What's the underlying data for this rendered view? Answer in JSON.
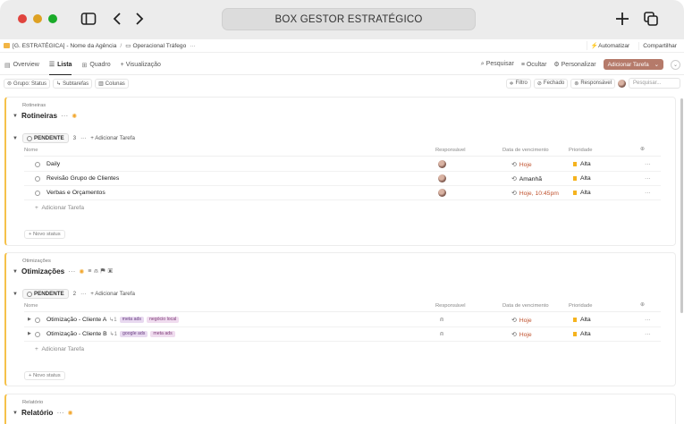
{
  "window": {
    "title": "BOX GESTOR ESTRATÉGICO"
  },
  "breadcrumb": {
    "space": "[G. ESTRATÉGICA] - Nome da Agência",
    "separator": "/",
    "list": "Operacional Tráfego",
    "more": "···",
    "automate": "Automatizar",
    "share": "Compartilhar"
  },
  "tabs": {
    "items": [
      {
        "label": "Overview",
        "icon": "▤"
      },
      {
        "label": "Lista",
        "icon": "☰"
      },
      {
        "label": "Quadro",
        "icon": "⊞"
      },
      {
        "label": "+ Visualização",
        "icon": ""
      }
    ],
    "search": "Pesquisar",
    "hide": "Ocultar",
    "customize": "Personalizar",
    "add_task": "Adicionar Tarefa"
  },
  "filters": {
    "group": "Grupo: Status",
    "subtasks": "Subtarefas",
    "columns": "Colunas",
    "filter": "Filtro",
    "closed": "Fechado",
    "assignee": "Responsável",
    "search_placeholder": "Pesquisar..."
  },
  "columns": {
    "name": "Nome",
    "assignee": "Responsável",
    "due": "Data de vencimento",
    "priority": "Prioridade"
  },
  "sections": [
    {
      "kicker": "Rotineiras",
      "title": "Rotineiras",
      "status": "PENDENTE",
      "count": "3",
      "add_task_label": "+ Adicionar Tarefa",
      "tasks": [
        {
          "name": "Daily",
          "due": "Hoje",
          "priority": "Alta"
        },
        {
          "name": "Revisão Grupo de Clientes",
          "due": "Amanhã",
          "priority": "Alta"
        },
        {
          "name": "Verbas e Orçamentos",
          "due": "Hoje, 10:45pm",
          "priority": "Alta"
        }
      ],
      "add_row": "Adicionar Tarefa",
      "new_status": "+ Novo status"
    },
    {
      "kicker": "Otimizações",
      "title": "Otimizações",
      "status": "PENDENTE",
      "count": "2",
      "add_task_label": "+ Adicionar Tarefa",
      "tasks": [
        {
          "name": "Otimização - Cliente A",
          "subcount": "1",
          "tags": [
            "meta ads",
            "negócio local"
          ],
          "due": "Hoje",
          "priority": "Alta"
        },
        {
          "name": "Otimização - Cliente B",
          "subcount": "1",
          "tags": [
            "google ads",
            "meta ads"
          ],
          "due": "Hoje",
          "priority": "Alta"
        }
      ],
      "add_row": "Adicionar Tarefa",
      "new_status": "+ Novo status"
    },
    {
      "kicker": "Relatório",
      "title": "Relatório"
    }
  ],
  "colors": {
    "accent_section": "#f5c14a",
    "due_red": "#c0532f",
    "flag": "#f5b31e",
    "add_button": "#b57a6a"
  }
}
